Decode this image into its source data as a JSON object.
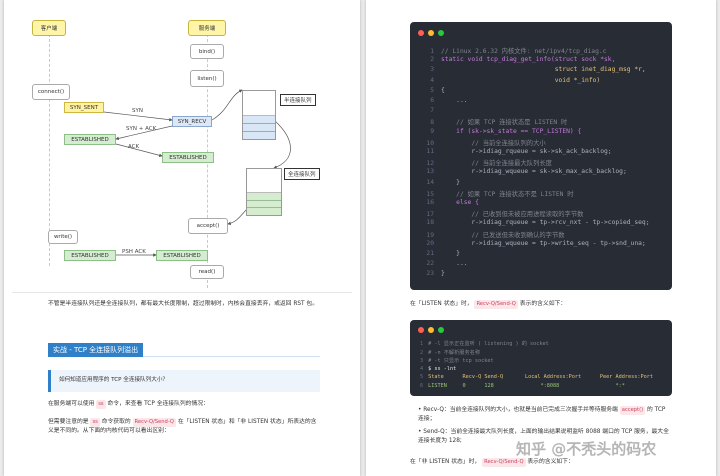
{
  "diagram": {
    "client_title": "客户端",
    "server_title": "服务端",
    "bind": "bind()",
    "listen": "listen()",
    "connect": "connect()",
    "accept": "accept()",
    "write": "write()",
    "read": "read()",
    "syn_sent": "SYN_SENT",
    "syn_recv": "SYN_RECV",
    "established": "ESTABLISHED",
    "syn": "SYN",
    "syn_ack": "SYN + ACK",
    "ack": "ACK",
    "psh_ack": "PSH ACK",
    "half_queue": "半连接队列",
    "full_queue": "全连接队列"
  },
  "left_text": {
    "p1": "不管是半连接队列还是全连接队列，都有最大长度限制，超过限制时，内核会直接丢弃，或返回 RST 包。",
    "heading": "实战 - TCP 全连接队列溢出",
    "callout": "如何知道应用程序的 TCP 全连接队列大小？",
    "p2a": "在服务端可以使用",
    "p2_cmd": "ss",
    "p2b": "命令，来查看 TCP 全连接队列的情况：",
    "p3a": "但需要注意的是",
    "p3_cmd": "ss",
    "p3b": "命令获取的",
    "p3_tag": "Recv-Q/Send-Q",
    "p3c": "在「LISTEN 状态」和「非 LISTEN 状态」所表达的含义是不同的。从下面的内核代码可以看出区别："
  },
  "code1": {
    "lines": [
      {
        "n": "1",
        "t": "// Linux 2.6.32 内核文件: net/ipv4/tcp_diag.c"
      },
      {
        "n": "2",
        "t": "static void tcp_diag_get_info(struct sock *sk,"
      },
      {
        "n": "3",
        "t": "                              struct inet_diag_msg *r,"
      },
      {
        "n": "4",
        "t": "                              void *_info)"
      },
      {
        "n": "5",
        "t": "{"
      },
      {
        "n": "6",
        "t": "    ..."
      },
      {
        "n": "7",
        "t": ""
      },
      {
        "n": "8",
        "t": "    // 如果 TCP 连接状态是 LISTEN 时"
      },
      {
        "n": "9",
        "t": "    if (sk->sk_state == TCP_LISTEN) {"
      },
      {
        "n": "10",
        "t": "        // 当前全连接队列的大小"
      },
      {
        "n": "11",
        "t": "        r->idiag_rqueue = sk->sk_ack_backlog;"
      },
      {
        "n": "12",
        "t": "        // 当前全连接最大队列长度"
      },
      {
        "n": "13",
        "t": "        r->idiag_wqueue = sk->sk_max_ack_backlog;"
      },
      {
        "n": "14",
        "t": "    }"
      },
      {
        "n": "15",
        "t": "    // 如果 TCP 连接状态不是 LISTEN 时"
      },
      {
        "n": "16",
        "t": "    else {"
      },
      {
        "n": "17",
        "t": "        // 已收到但未被应用进程读取的字节数"
      },
      {
        "n": "18",
        "t": "        r->idiag_rqueue = tp->rcv_nxt - tp->copied_seq;"
      },
      {
        "n": "19",
        "t": "        // 已发送但未收到确认的字节数"
      },
      {
        "n": "20",
        "t": "        r->idiag_wqueue = tp->write_seq - tp->snd_una;"
      },
      {
        "n": "21",
        "t": "    }"
      },
      {
        "n": "22",
        "t": "    ..."
      },
      {
        "n": "23",
        "t": "}"
      }
    ]
  },
  "right_text": {
    "r1a": "在「LISTEN 状态」时，",
    "r1_tag": "Recv-Q/Send-Q",
    "r1b": "表示的含义如下：",
    "b1a": "Recv-Q：当前全连接队列的大小，也就是当前已完成三次握手并等待服务端",
    "b1_tag": "accept()",
    "b1b": "的 TCP 连接；",
    "b2": "Send-Q：当前全连接最大队列长度，上面的输出结果说明监听 8088 端口的 TCP 服务，最大全连接长度为 128;",
    "r2a": "在「非 LISTEN 状态」时，",
    "r2_tag": "Recv-Q/Send-Q",
    "r2b": "表示的含义如下："
  },
  "code2": {
    "lines": [
      {
        "n": "1",
        "t": "# -l 显示正在监听 ( listening ) 的 socket"
      },
      {
        "n": "2",
        "t": "# -n 不解析服务名称"
      },
      {
        "n": "3",
        "t": "# -t 只显示 tcp socket"
      },
      {
        "n": "4",
        "t": "$ ss -lnt"
      },
      {
        "n": "5",
        "t": "State      Recv-Q Send-Q       Local Address:Port      Peer Address:Port"
      },
      {
        "n": "6",
        "t": "LISTEN     0      128               *:8088                  *:*"
      }
    ]
  },
  "watermark": "知乎 @不秃头的码农",
  "colors": {
    "code_bg": "#282c34",
    "accent": "#2f80c9",
    "tag": "#d0405c"
  }
}
